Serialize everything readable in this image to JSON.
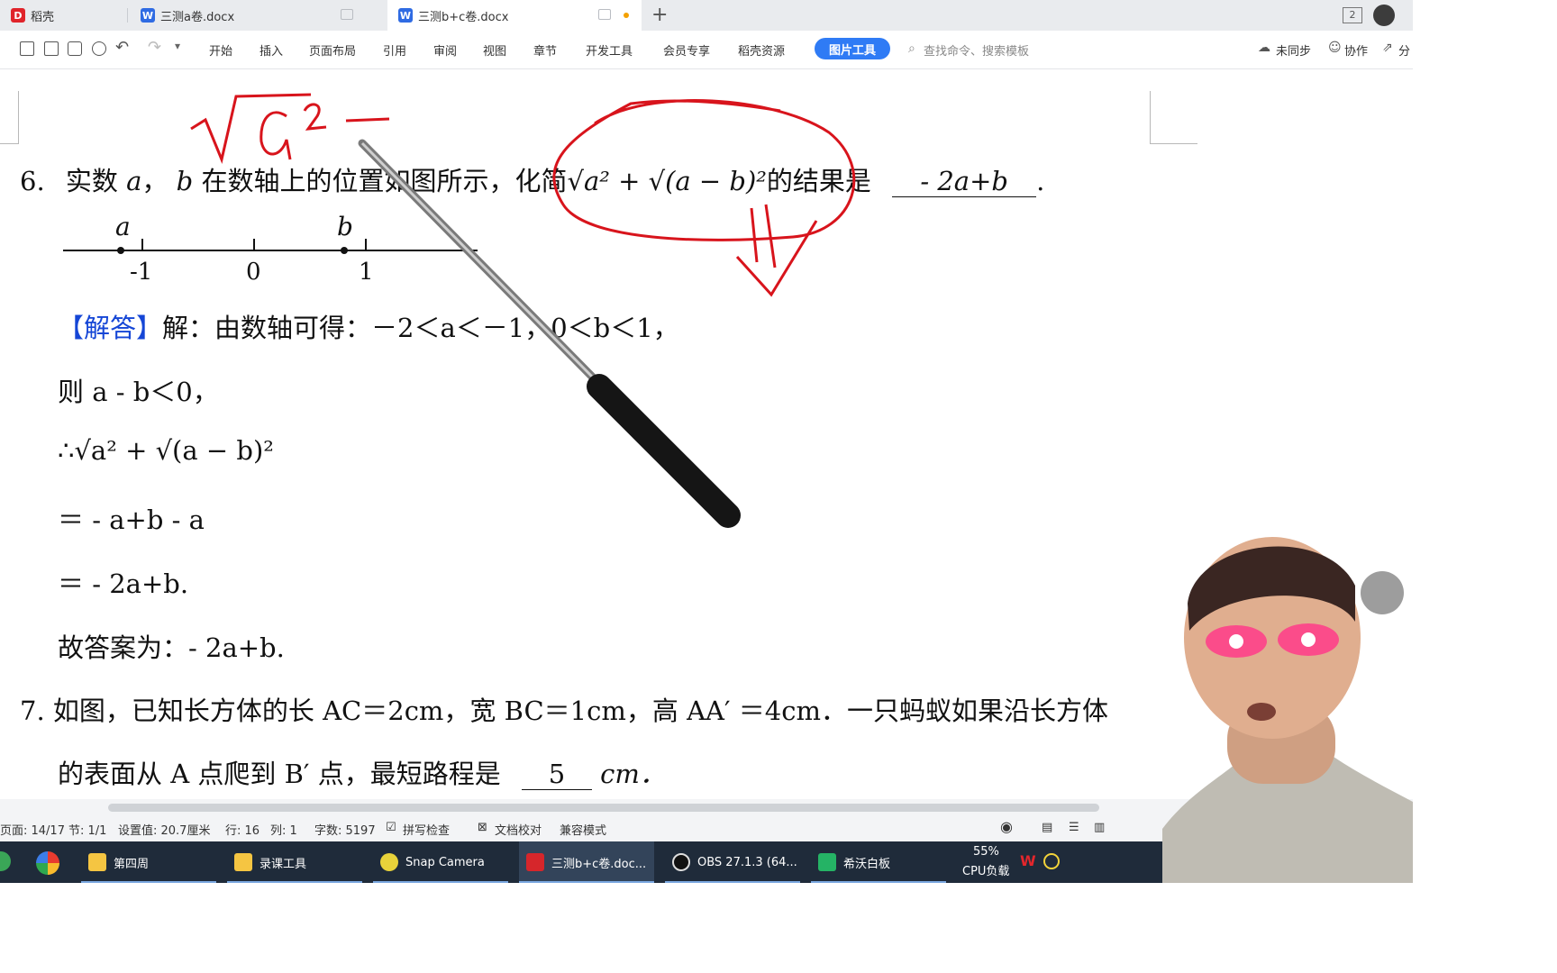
{
  "tabs": [
    {
      "label": "稻壳"
    },
    {
      "label": "三测a卷.docx"
    },
    {
      "label": "三测b+c卷.docx"
    }
  ],
  "toolbar": {
    "menus": [
      "开始",
      "插入",
      "页面布局",
      "引用",
      "审阅",
      "视图",
      "章节",
      "开发工具",
      "会员专享",
      "稻壳资源"
    ],
    "picture_tool": "图片工具",
    "search_placeholder": "查找命令、搜索模板",
    "sync": "未同步",
    "collab": "协作",
    "share": "分"
  },
  "document": {
    "q6": {
      "number": "6.",
      "text_a": "实数",
      "var_a": "a",
      "comma": "，",
      "var_b": "b",
      "text_b": "在数轴上的位置如图所示，化简",
      "expr": "√a² + √(a − b)²",
      "text_c": "的结果是",
      "answer": "- 2a+b",
      "end": "."
    },
    "numberline": {
      "label_a": "a",
      "label_b": "b",
      "ticks": [
        "-1",
        "0",
        "1"
      ]
    },
    "solution": {
      "tag": "【解答】",
      "line1": "解：由数轴可得：－2＜a＜－1，0＜b＜1，",
      "line2": "则 a - b＜0，",
      "line3": "∴√a² + √(a − b)²",
      "line4": "＝ - a+b - a",
      "line5": "＝ - 2a+b.",
      "line6": "故答案为：- 2a+b."
    },
    "q7": {
      "line1": "7.  如图，已知长方体的长 AC＝2cm，宽 BC＝1cm，高 AA′ ＝4cm．一只蚂蚁如果沿长方体",
      "line2a": "的表面从 A 点爬到 B′ 点，最短路程是",
      "answer": "5",
      "line2b": "cm．"
    }
  },
  "statusbar": {
    "page": "页面: 14/17",
    "section": "节: 1/1",
    "setting": "设置值: 20.7厘米",
    "row": "行: 16",
    "col": "列: 1",
    "words": "字数: 5197",
    "spell": "拼写检查",
    "proof": "文档校对",
    "compat": "兼容模式"
  },
  "taskbar": {
    "items": [
      "第四周",
      "录课工具",
      "Snap Camera",
      "三测b+c卷.doc...",
      "OBS 27.1.3 (64...",
      "希沃白板"
    ],
    "cpu": "55%",
    "cpu_label": "CPU负载"
  },
  "colors": {
    "accent": "#2f7bf5",
    "annotation": "#d8141c",
    "solution_tag": "#1546d6"
  }
}
